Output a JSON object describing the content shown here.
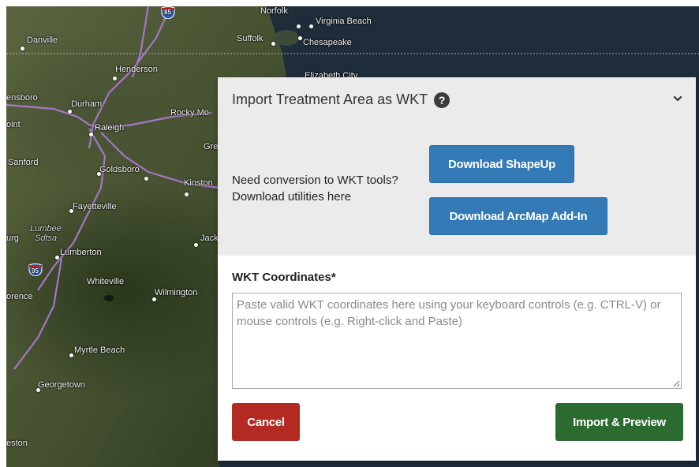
{
  "map": {
    "cities": [
      "Norfolk",
      "Virginia Beach",
      "Suffolk",
      "Chesapeake",
      "Danville",
      "Henderson",
      "Elizabeth City",
      "ensboro",
      "Durham",
      "Rocky Mo",
      "oint",
      "Raleigh",
      "Gre",
      "Sanford",
      "Goldsboro",
      "Kinston",
      "Fayetteville",
      "Lumbee",
      "Sdtsa",
      "urg",
      "Jack",
      "Lumberton",
      "Whiteville",
      "Wilmington",
      "orence",
      "Myrtle Beach",
      "Georgetown",
      "eston"
    ],
    "shields": [
      "85",
      "95"
    ]
  },
  "dialog": {
    "title": "Import Treatment Area as WKT",
    "help_icon": "?",
    "hint_line1": "Need conversion to WKT tools?",
    "hint_line2": "Download utilities here",
    "download_shapeup": "Download ShapeUp",
    "download_arcmap": "Download ArcMap Add-In",
    "wkt_label": "WKT Coordinates*",
    "wkt_value": "",
    "wkt_placeholder": "Paste valid WKT coordinates here using your keyboard controls (e.g. CTRL-V) or mouse controls (e.g. Right-click and Paste)",
    "cancel": "Cancel",
    "import": "Import & Preview"
  },
  "icons": {
    "help": "question-circle-icon",
    "collapse": "chevron-down-icon",
    "resize": "resize-grip-icon"
  },
  "colors": {
    "primary_button": "#337ab7",
    "cancel_button": "#b32a23",
    "import_button": "#2c6b2f",
    "dialog_header_bg": "#ebebeb"
  }
}
